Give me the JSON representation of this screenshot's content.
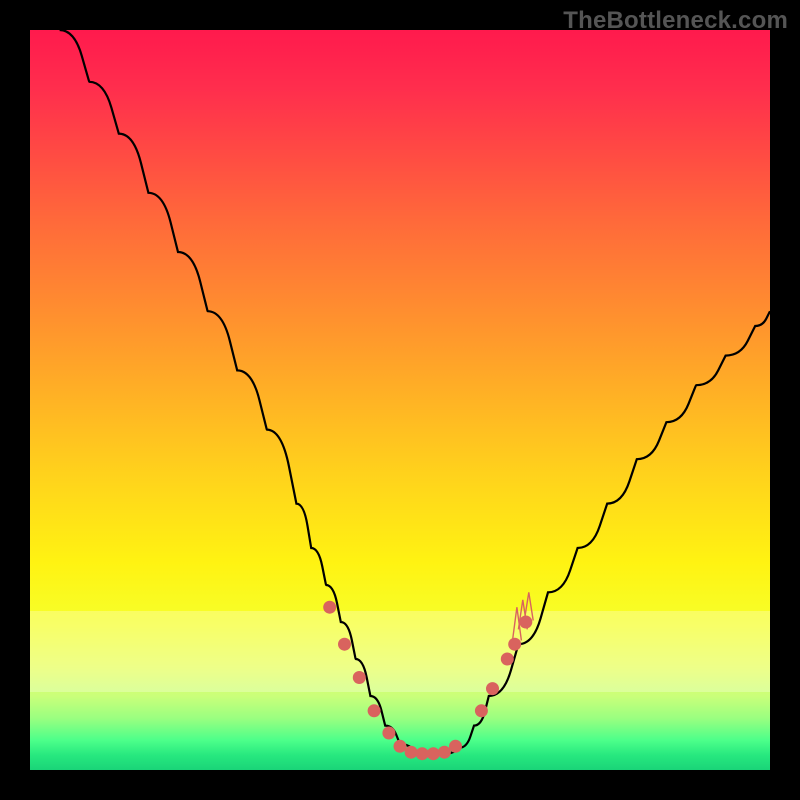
{
  "watermark": "TheBottleneck.com",
  "colors": {
    "dot": "#d9635e",
    "curve": "#000000",
    "frame": "#000000"
  },
  "chart_data": {
    "type": "line",
    "title": "",
    "xlabel": "",
    "ylabel": "",
    "xlim": [
      0,
      100
    ],
    "ylim": [
      0,
      100
    ],
    "grid": false,
    "legend": false,
    "series": [
      {
        "name": "bottleneck-curve",
        "x": [
          4,
          8,
          12,
          16,
          20,
          24,
          28,
          32,
          36,
          38,
          40,
          42,
          44,
          46,
          48,
          50,
          52,
          54,
          56,
          58,
          60,
          62,
          66,
          70,
          74,
          78,
          82,
          86,
          90,
          94,
          98,
          100
        ],
        "y": [
          100,
          93,
          86,
          78,
          70,
          62,
          54,
          46,
          36,
          30,
          25,
          20,
          15,
          10,
          6,
          3.5,
          2.5,
          2.2,
          2.2,
          3,
          6,
          10,
          17,
          24,
          30,
          36,
          42,
          47,
          52,
          56,
          60,
          62
        ]
      }
    ],
    "markers": [
      {
        "x": 40.5,
        "y": 22
      },
      {
        "x": 42.5,
        "y": 17
      },
      {
        "x": 44.5,
        "y": 12.5
      },
      {
        "x": 46.5,
        "y": 8
      },
      {
        "x": 48.5,
        "y": 5
      },
      {
        "x": 50.0,
        "y": 3.2
      },
      {
        "x": 51.5,
        "y": 2.4
      },
      {
        "x": 53.0,
        "y": 2.2
      },
      {
        "x": 54.5,
        "y": 2.2
      },
      {
        "x": 56.0,
        "y": 2.4
      },
      {
        "x": 57.5,
        "y": 3.2
      },
      {
        "x": 61.0,
        "y": 8
      },
      {
        "x": 62.5,
        "y": 11
      },
      {
        "x": 64.5,
        "y": 15
      },
      {
        "x": 65.5,
        "y": 17
      },
      {
        "x": 67.0,
        "y": 20
      }
    ],
    "spikes": [
      {
        "x": 65.8,
        "dx": 0.6,
        "y0": 17.5,
        "y1": 22
      },
      {
        "x": 66.6,
        "dx": 0.6,
        "y0": 19.0,
        "y1": 23
      },
      {
        "x": 67.4,
        "dx": 0.6,
        "y0": 20.2,
        "y1": 24
      }
    ]
  }
}
